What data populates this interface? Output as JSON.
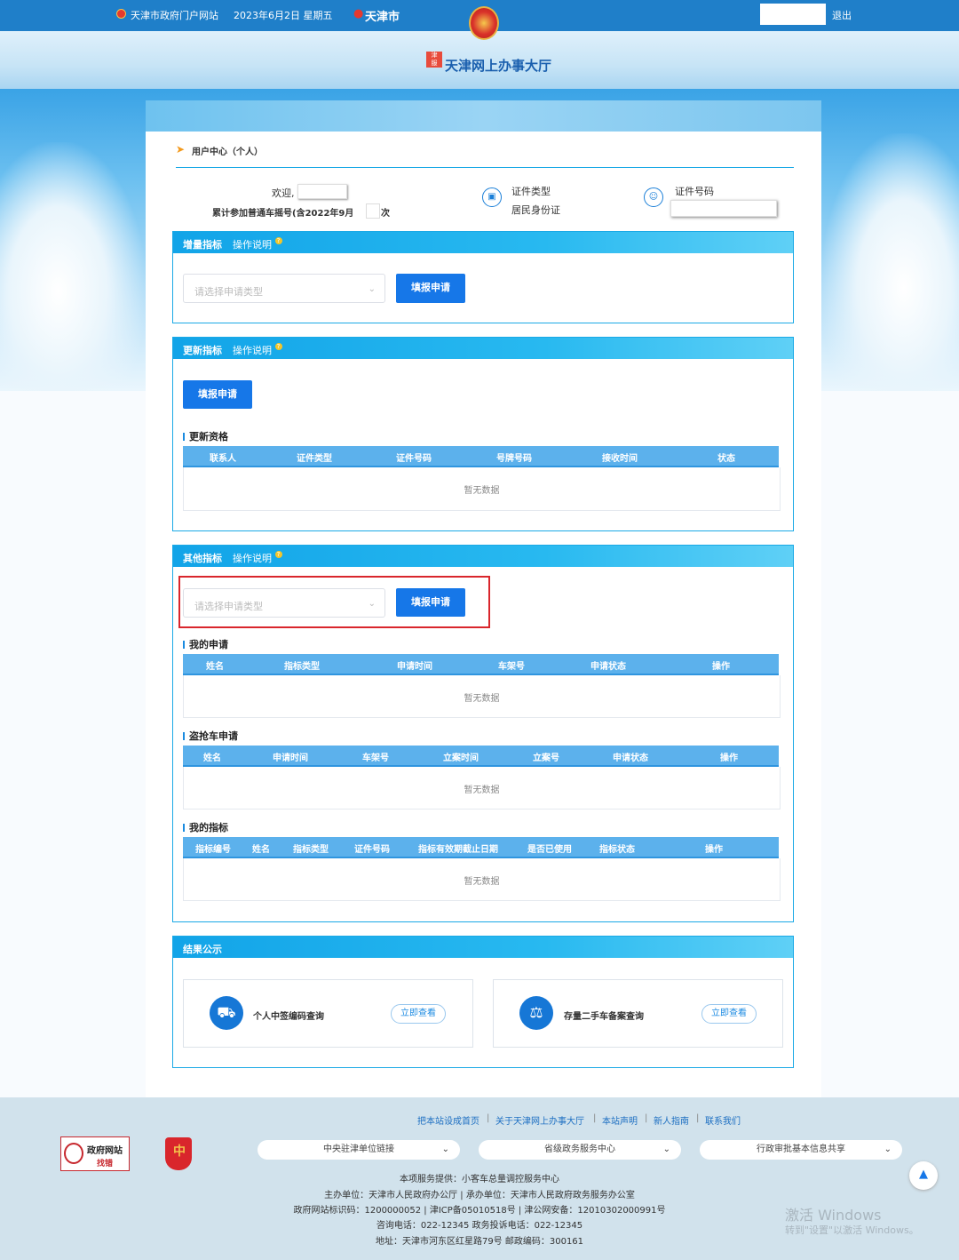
{
  "header": {
    "site_link": "天津市政府门户网站",
    "date": "2023年6月2日 星期五",
    "city": "天津市",
    "logo_title": "天津网上办事大厅",
    "logout": "退出"
  },
  "breadcrumb": "用户中心（个人）",
  "user": {
    "welcome": "欢迎,",
    "count_prefix": "累计参加普通车摇号(含2022年9月",
    "count_suffix": "次",
    "id_type_label": "证件类型",
    "id_type_value": "居民身份证",
    "id_number_label": "证件号码"
  },
  "sections": {
    "increment": {
      "title": "增量指标",
      "help": "操作说明",
      "select_placeholder": "请选择申请类型",
      "button": "填报申请"
    },
    "update": {
      "title": "更新指标",
      "help": "操作说明",
      "button": "填报申请",
      "sub_title": "更新资格",
      "columns": [
        "联系人",
        "证件类型",
        "证件号码",
        "号牌号码",
        "接收时间",
        "状态"
      ],
      "empty": "暂无数据"
    },
    "other": {
      "title": "其他指标",
      "help": "操作说明",
      "select_placeholder": "请选择申请类型",
      "button": "填报申请",
      "my_apply": {
        "title": "我的申请",
        "columns": [
          "姓名",
          "指标类型",
          "申请时间",
          "车架号",
          "申请状态",
          "操作"
        ],
        "empty": "暂无数据"
      },
      "stolen": {
        "title": "盗抢车申请",
        "columns": [
          "姓名",
          "申请时间",
          "车架号",
          "立案时间",
          "立案号",
          "申请状态",
          "操作"
        ],
        "empty": "暂无数据"
      },
      "my_index": {
        "title": "我的指标",
        "columns": [
          "指标编号",
          "姓名",
          "指标类型",
          "证件号码",
          "指标有效期截止日期",
          "是否已使用",
          "指标状态",
          "操作"
        ],
        "empty": "暂无数据"
      }
    },
    "result": {
      "title": "结果公示",
      "cards": [
        {
          "label": "个人中签编码查询",
          "button": "立即查看"
        },
        {
          "label": "存量二手车备案查询",
          "button": "立即查看"
        }
      ]
    }
  },
  "footer": {
    "links": [
      "把本站设成首页",
      "关于天津网上办事大厅",
      "本站声明",
      "新人指南",
      "联系我们"
    ],
    "badge_line1": "政府网站",
    "badge_line2": "找错",
    "selects": [
      "中央驻津单位链接",
      "省级政务服务中心",
      "行政审批基本信息共享"
    ],
    "lines": [
      "本项服务提供：小客车总量调控服务中心",
      "主办单位：天津市人民政府办公厅 | 承办单位：天津市人民政府政务服务办公室",
      "政府网站标识码：1200000052 | 津ICP备05010518号 | 津公网安备：12010302000991号",
      "咨询电话：022-12345 政务投诉电话：022-12345",
      "地址：天津市河东区红星路79号 邮政编码：300161"
    ],
    "watermark_1": "激活 Windows",
    "watermark_2": "转到\"设置\"以激活 Windows。"
  }
}
